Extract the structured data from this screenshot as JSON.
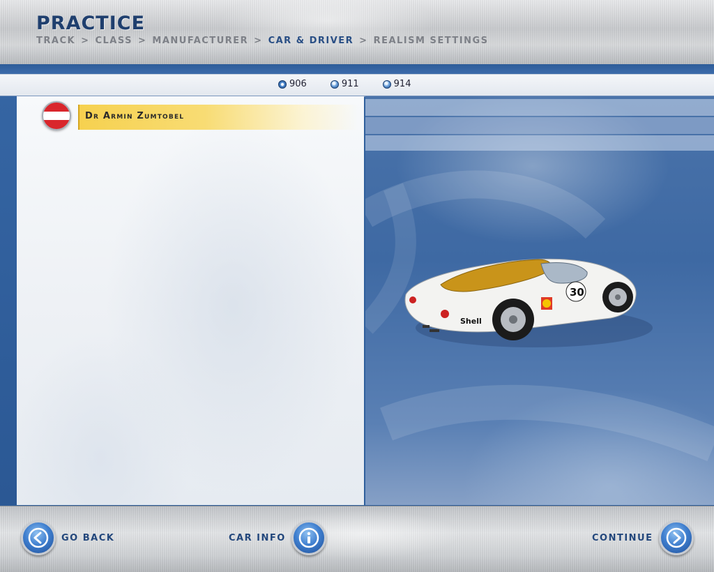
{
  "header": {
    "title": "PRACTICE",
    "breadcrumb": {
      "track": "TRACK",
      "class": "CLASS",
      "manufacturer": "MANUFACTURER",
      "car_driver": "CAR & DRIVER",
      "realism": "REALISM SETTINGS",
      "separator": ">"
    }
  },
  "car_tabs": [
    {
      "label": "906",
      "selected": true
    },
    {
      "label": "911",
      "selected": false
    },
    {
      "label": "914",
      "selected": false
    }
  ],
  "driver": {
    "name": "Dr Armin Zumtobel",
    "flag": "austria-flag"
  },
  "car": {
    "number": "30",
    "sponsor": "Shell"
  },
  "footer": {
    "go_back": "GO BACK",
    "car_info": "CAR INFO",
    "continue": "CONTINUE"
  },
  "colors": {
    "accent_blue": "#2a4f85",
    "driver_highlight": "#f6d14f",
    "flag_red": "#d9262c"
  }
}
